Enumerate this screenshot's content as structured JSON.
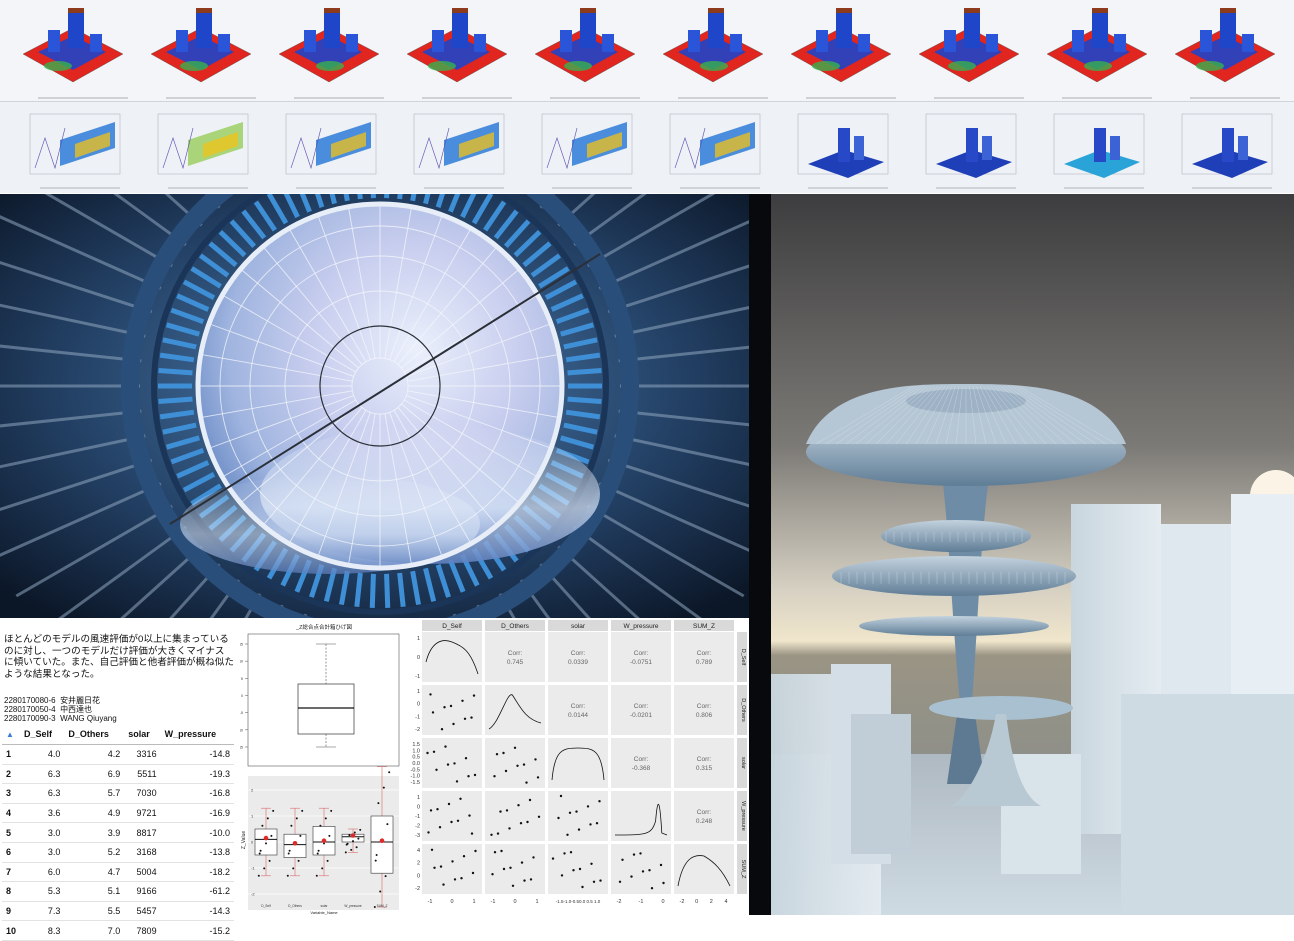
{
  "report": {
    "description": "ほとんどのモデルの風速評価が0以上に集まっているのに対し、一つのモデルだけ評価が大きくマイナスに傾いていた。また、自己評価と他者評価が概ね似たような結果となった。",
    "authors": [
      {
        "id": "2280170080-6",
        "name": "安井麗日花"
      },
      {
        "id": "2280170050-4",
        "name": "中西達也"
      },
      {
        "id": "2280170090-3",
        "name": "WANG Qiuyang"
      }
    ]
  },
  "table": {
    "sort_icon": "sort-asc-icon",
    "columns": [
      "D_Self",
      "D_Others",
      "solar",
      "W_pressure"
    ],
    "rows": [
      {
        "idx": "1",
        "d_self": "4.0",
        "d_others": "4.2",
        "solar": "3316",
        "w_pressure": "-14.8"
      },
      {
        "idx": "2",
        "d_self": "6.3",
        "d_others": "6.9",
        "solar": "5511",
        "w_pressure": "-19.3"
      },
      {
        "idx": "3",
        "d_self": "6.3",
        "d_others": "5.7",
        "solar": "7030",
        "w_pressure": "-16.8"
      },
      {
        "idx": "4",
        "d_self": "3.6",
        "d_others": "4.9",
        "solar": "9721",
        "w_pressure": "-16.9"
      },
      {
        "idx": "5",
        "d_self": "3.0",
        "d_others": "3.9",
        "solar": "8817",
        "w_pressure": "-10.0"
      },
      {
        "idx": "6",
        "d_self": "3.0",
        "d_others": "5.2",
        "solar": "3168",
        "w_pressure": "-13.8"
      },
      {
        "idx": "7",
        "d_self": "6.0",
        "d_others": "4.7",
        "solar": "5004",
        "w_pressure": "-18.2"
      },
      {
        "idx": "8",
        "d_self": "5.3",
        "d_others": "5.1",
        "solar": "9166",
        "w_pressure": "-61.2"
      },
      {
        "idx": "9",
        "d_self": "7.3",
        "d_others": "5.5",
        "solar": "5457",
        "w_pressure": "-14.3"
      },
      {
        "idx": "10",
        "d_self": "8.3",
        "d_others": "7.0",
        "solar": "7809",
        "w_pressure": "-15.2"
      }
    ]
  },
  "boxplot_top": {
    "title": "_Z総合点合計箱ひげ図",
    "yticks": [
      "15",
      "10",
      "5",
      "0",
      "-5",
      "-10",
      "-15"
    ],
    "stats": {
      "min": -12,
      "q1": -3,
      "median": 1,
      "q3": 5,
      "max": 17
    }
  },
  "boxplot_bottom": {
    "ylabel": "Z_Value",
    "xlabel": "Variable_Name",
    "categories": [
      "D_Self",
      "D_Others",
      "solar",
      "W_pressure",
      "SUM_Z"
    ],
    "yticks": [
      "2",
      "1",
      "0",
      "-1",
      "-2"
    ]
  },
  "pairs": {
    "variables": [
      "D_Self",
      "D_Others",
      "solar",
      "W_pressure",
      "SUM_Z"
    ],
    "corr_label": "Corr:",
    "corr": [
      {
        "row": 0,
        "col": 1,
        "value": "0.745"
      },
      {
        "row": 0,
        "col": 2,
        "value": "0.0339"
      },
      {
        "row": 0,
        "col": 3,
        "value": "-0.0751"
      },
      {
        "row": 0,
        "col": 4,
        "value": "0.789"
      },
      {
        "row": 1,
        "col": 2,
        "value": "0.0144"
      },
      {
        "row": 1,
        "col": 3,
        "value": "-0.0201"
      },
      {
        "row": 1,
        "col": 4,
        "value": "0.806"
      },
      {
        "row": 2,
        "col": 3,
        "value": "-0.368"
      },
      {
        "row": 2,
        "col": 4,
        "value": "0.315"
      },
      {
        "row": 3,
        "col": 4,
        "value": "0.248"
      }
    ],
    "row_ticks": [
      [
        "1",
        "0",
        "-1"
      ],
      [
        "1",
        "0",
        "-1",
        "-2"
      ],
      [
        "1.5",
        "1.0",
        "0.5",
        "0.0",
        "-0.5",
        "-1.0",
        "-1.5"
      ],
      [
        "1",
        "0",
        "-1",
        "-2",
        "-3"
      ],
      [
        "4",
        "2",
        "0",
        "-2"
      ]
    ],
    "col_ticks": [
      [
        "-1",
        "0",
        "1"
      ],
      [
        "-1",
        "0",
        "1"
      ],
      [
        "-1.5-1.0-0.50.0 0.5 1.0"
      ],
      [
        "-2",
        "-1",
        "0"
      ],
      [
        "-2",
        "0",
        "2",
        "4"
      ]
    ]
  },
  "icons": {
    "stadium": "stadium-oculus-render",
    "tower": "mushroom-tower-render",
    "sim_thumbs": "cfd-simulation-thumbnail"
  },
  "colors": {
    "stadium_blue": "#3f8fd6",
    "sky": "#c9d6ee",
    "sim_red": "#e0261e",
    "sim_blue": "#1f45c9",
    "sim_green": "#37b24d",
    "tower_sky_top": "#3f3f41",
    "tower_glow": "#f1e3c2"
  }
}
